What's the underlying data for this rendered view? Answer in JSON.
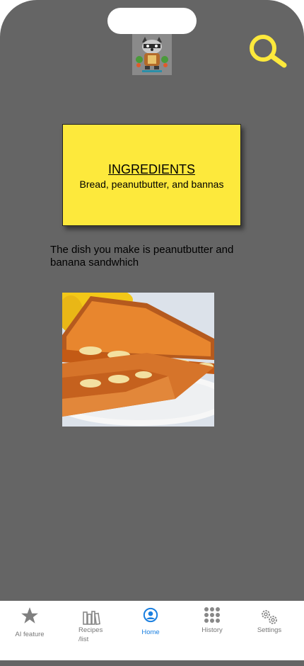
{
  "card": {
    "title": "INGREDIENTS",
    "body": "Bread, peanutbutter, and bannas"
  },
  "result": {
    "text": "The dish you make is peanutbutter and banana sandwhich"
  },
  "tabs": [
    {
      "label": "AI feature",
      "icon": "star-icon"
    },
    {
      "label": "Recipes /list",
      "icon": "books-icon"
    },
    {
      "label": "Home",
      "icon": "user-circle-icon",
      "active": true
    },
    {
      "label": "History",
      "icon": "grid-dots-icon"
    },
    {
      "label": "Settings",
      "icon": "gears-icon"
    }
  ],
  "colors": {
    "background": "#656565",
    "accent": "#fde93c",
    "active_tab": "#1a7fe0"
  }
}
